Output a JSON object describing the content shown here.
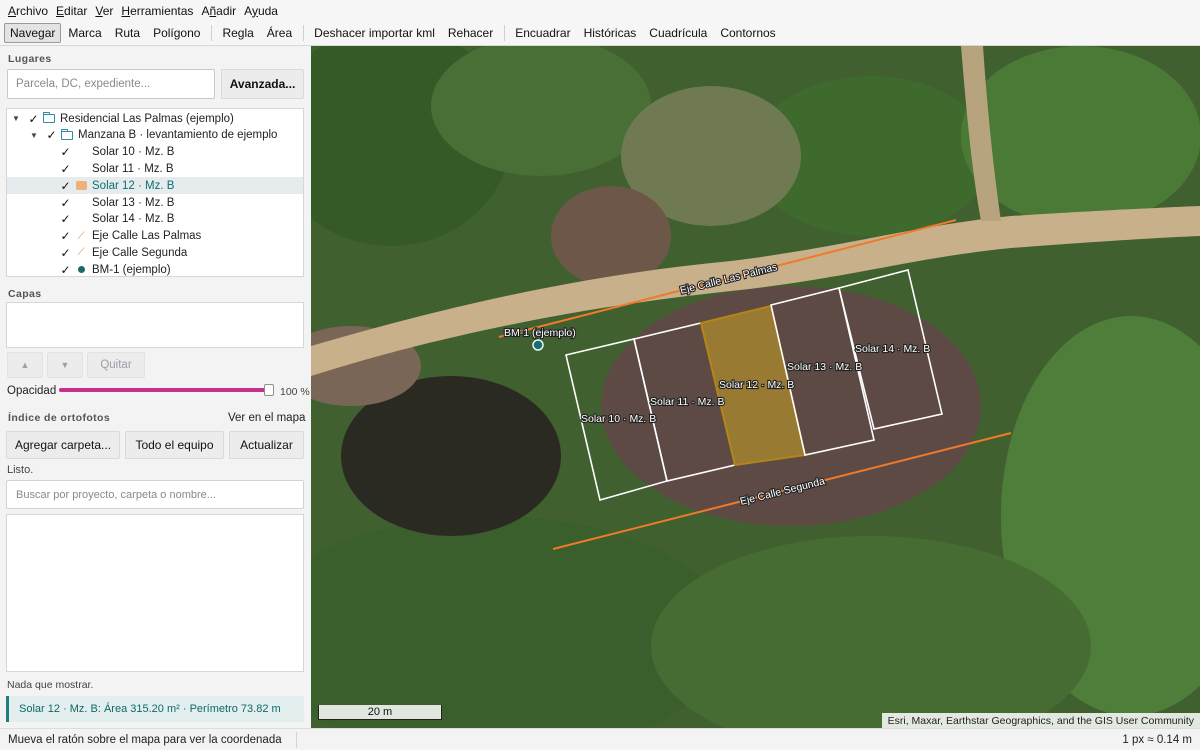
{
  "menu": [
    {
      "pre": "",
      "u": "A",
      "post": "rchivo"
    },
    {
      "pre": "",
      "u": "E",
      "post": "ditar"
    },
    {
      "pre": "",
      "u": "V",
      "post": "er"
    },
    {
      "pre": "",
      "u": "H",
      "post": "erramientas"
    },
    {
      "pre": "A",
      "u": "ñ",
      "post": "adir"
    },
    {
      "pre": "A",
      "u": "y",
      "post": "uda"
    }
  ],
  "toolbar": {
    "navegar": "Navegar",
    "marca": "Marca",
    "ruta": "Ruta",
    "poligono": "Polígono",
    "regla": "Regla",
    "area": "Área",
    "deshacer": "Deshacer importar kml",
    "rehacer": "Rehacer",
    "encuadrar": "Encuadrar",
    "historicas": "Históricas",
    "cuadricula": "Cuadrícula",
    "contornos": "Contornos"
  },
  "places": {
    "title": "Lugares",
    "search_placeholder": "Parcela, DC, expediente...",
    "advanced": "Avanzada...",
    "tree": [
      {
        "label": "Residencial Las Palmas (ejemplo)",
        "type": "folder",
        "depth": 0,
        "expanded": true,
        "checked": true,
        "selected": false
      },
      {
        "label": "Manzana B · levantamiento de ejemplo",
        "type": "folder",
        "depth": 1,
        "expanded": true,
        "checked": true,
        "selected": false
      },
      {
        "label": "Solar 10 · Mz. B",
        "type": "polygon",
        "depth": 2,
        "checked": true,
        "selected": false
      },
      {
        "label": "Solar 11 · Mz. B",
        "type": "polygon",
        "depth": 2,
        "checked": true,
        "selected": false
      },
      {
        "label": "Solar 12 · Mz. B",
        "type": "polygon-filled",
        "depth": 2,
        "checked": true,
        "selected": true
      },
      {
        "label": "Solar 13 · Mz. B",
        "type": "polygon",
        "depth": 2,
        "checked": true,
        "selected": false
      },
      {
        "label": "Solar 14 · Mz. B",
        "type": "polygon",
        "depth": 2,
        "checked": true,
        "selected": false
      },
      {
        "label": "Eje Calle Las Palmas",
        "type": "line",
        "depth": 2,
        "checked": true,
        "selected": false
      },
      {
        "label": "Eje Calle Segunda",
        "type": "line",
        "depth": 2,
        "checked": true,
        "selected": false
      },
      {
        "label": "BM-1 (ejemplo)",
        "type": "point",
        "depth": 2,
        "checked": true,
        "selected": false
      }
    ]
  },
  "layers": {
    "title": "Capas",
    "up": "▲",
    "down": "▼",
    "remove": "Quitar",
    "opacity_label": "Opacidad",
    "opacity_value": "100 %",
    "opacity_fraction": 1.0
  },
  "ortho": {
    "title": "Índice de ortofotos",
    "show_on_map": "Ver en el mapa",
    "add_folder": "Agregar carpeta...",
    "all_computer": "Todo el equipo",
    "refresh": "Actualizar",
    "status": "Listo.",
    "search_placeholder": "Buscar por proyecto, carpeta o nombre...",
    "empty": "Nada que mostrar."
  },
  "selection_info": "Solar 12 · Mz. B: Área 315.20 m² · Perímetro 73.82 m",
  "map": {
    "labels": {
      "bm": "BM-1 (ejemplo)",
      "road1": "Eje Calle Las Palmas",
      "road2": "Eje Calle Segunda",
      "solar10": "Solar 10 · Mz. B",
      "solar11": "Solar 11 · Mz. B",
      "solar12": "Solar 12 · Mz. B",
      "solar13": "Solar 13 · Mz. B",
      "solar14": "Solar 14 · Mz. B"
    },
    "scale": "20 m",
    "attribution": "Esri, Maxar, Earthstar Geographics, and the GIS User Community",
    "colors": {
      "road_line": "#f07a2a",
      "selected_fill": "#c9a227",
      "parcel_outline": "#ffffff",
      "point": "#1a6e73"
    }
  },
  "status": {
    "hint": "Mueva el ratón sobre el mapa para ver la coordenada",
    "resolution": "1 px ≈ 0.14 m"
  }
}
